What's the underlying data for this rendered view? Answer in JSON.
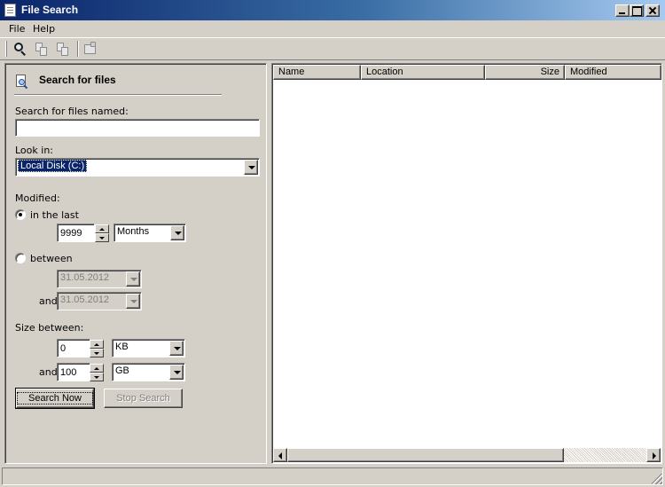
{
  "window": {
    "title": "File Search"
  },
  "menu": {
    "items": [
      "File",
      "Help"
    ]
  },
  "toolbar": {
    "buttons": [
      {
        "icon": "search-icon"
      },
      {
        "icon": "copy-icon"
      },
      {
        "icon": "move-icon"
      },
      {
        "icon": "properties-icon"
      }
    ]
  },
  "search_panel": {
    "heading": "Search for files",
    "named_label": "Search for files named:",
    "named_value": "",
    "look_in_label": "Look in:",
    "look_in_value": "Local Disk (C:)",
    "modified_label": "Modified:",
    "in_the_last_label": "in the last",
    "in_the_last_selected": true,
    "in_the_last_value": "9999",
    "in_the_last_unit": "Months",
    "between_label": "between",
    "between_selected": false,
    "between_from": "31.05.2012",
    "and_label": "and",
    "between_to": "31.05.2012",
    "size_label": "Size between:",
    "size_min_value": "0",
    "size_min_unit": "KB",
    "size_and_label": "and",
    "size_max_value": "100",
    "size_max_unit": "GB",
    "search_now_label": "Search Now",
    "stop_search_label": "Stop Search"
  },
  "results": {
    "columns": [
      "Name",
      "Location",
      "Size",
      "Modified"
    ],
    "rows": []
  },
  "colors": {
    "face": "#d4d0c8",
    "title_start": "#0a246a",
    "title_end": "#a6caf0",
    "selection": "#0a246a"
  }
}
